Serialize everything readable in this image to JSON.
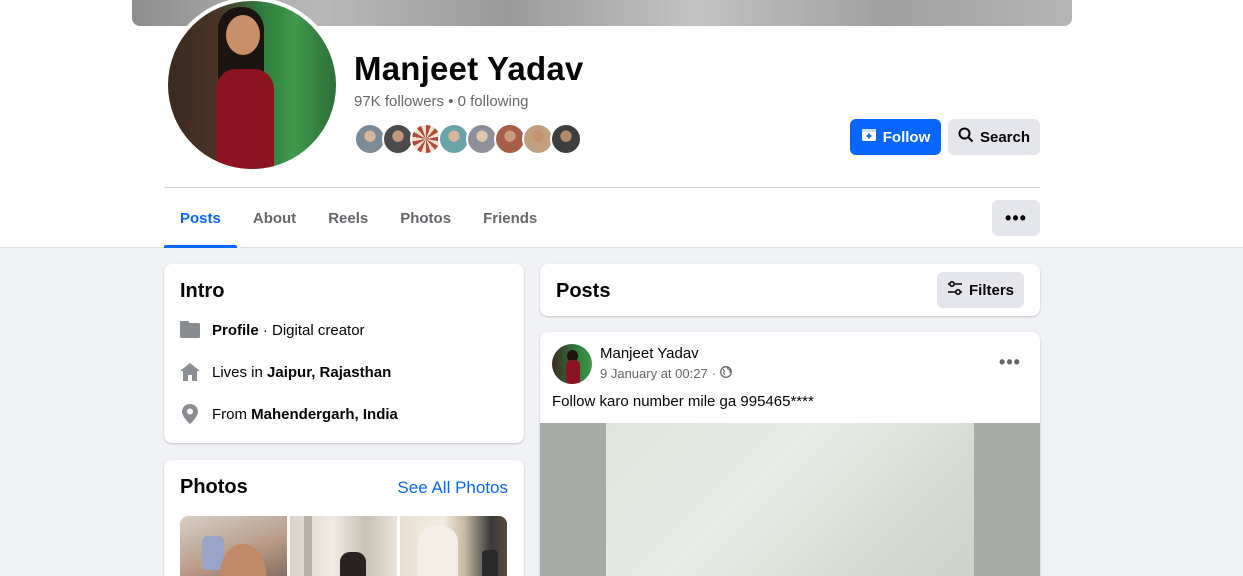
{
  "profile": {
    "name": "Manjeet Yadav",
    "stats": "97K followers • 0 following",
    "follow_label": "Follow",
    "search_label": "Search",
    "more_label": "•••"
  },
  "friends_avatars": [
    "#7a8a96",
    "#4b4b4b",
    "#b04a3a",
    "#6aa3a8",
    "#8f8f9a",
    "#a65e48",
    "#c0a080",
    "#3e3e3e"
  ],
  "tabs": [
    {
      "label": "Posts",
      "active": true
    },
    {
      "label": "About",
      "active": false
    },
    {
      "label": "Reels",
      "active": false
    },
    {
      "label": "Photos",
      "active": false
    },
    {
      "label": "Friends",
      "active": false
    }
  ],
  "intro": {
    "title": "Intro",
    "profile_strong": "Profile",
    "profile_rest": " · Digital creator",
    "lives_prefix": "Lives in ",
    "lives_place": "Jaipur, Rajasthan",
    "from_prefix": "From ",
    "from_place": "Mahendergarh, India"
  },
  "photos": {
    "title": "Photos",
    "see_all": "See All Photos"
  },
  "posts": {
    "title": "Posts",
    "filters_label": "Filters"
  },
  "post": {
    "author": "Manjeet Yadav",
    "date": "9 January at 00:27",
    "separator": "·",
    "text": "Follow karo number mile ga 995465****",
    "more_label": "•••"
  },
  "colors": {
    "accent": "#0866ff",
    "secondary_button": "#e4e6eb",
    "muted_text": "#65676b"
  }
}
